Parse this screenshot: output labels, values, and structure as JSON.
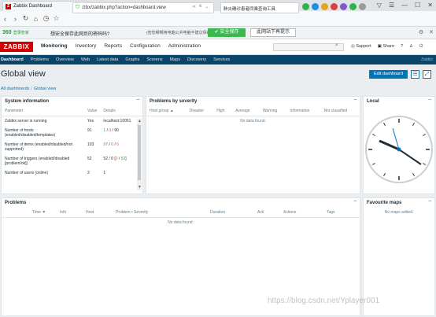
{
  "browser": {
    "tab_title": "Zabbix Dashboard",
    "tab_close": "×",
    "new_tab": "+",
    "url": "/zbx/zabbix.php?action=dashboard.view",
    "search_text": "肺炎确诊患者同乘查询工具",
    "window_controls": [
      "▽",
      "☰",
      "—",
      "☐",
      "✕"
    ]
  },
  "infobar": {
    "logo": "360",
    "logo_sub": "登录管家",
    "question": "想安全保存此网页的密码吗?",
    "note": "(密您哪哪用电脑公共电脑不建议保存)",
    "save_button": "✔ 安全保存",
    "never_button": "此网站下再提示"
  },
  "topnav": {
    "logo": "ZABBIX",
    "menu": [
      "Monitoring",
      "Inventory",
      "Reports",
      "Configuration",
      "Administration"
    ],
    "links": [
      "Support",
      "Share",
      "?"
    ]
  },
  "submenu": {
    "items": [
      "Dashboard",
      "Problems",
      "Overview",
      "Web",
      "Latest data",
      "Graphs",
      "Screens",
      "Maps",
      "Discovery",
      "Services"
    ],
    "brand": "Zabbix"
  },
  "page": {
    "title": "Global view",
    "edit_button": "Edit dashboard",
    "breadcrumbs": [
      "All dashboards",
      "Global view"
    ]
  },
  "system_info": {
    "title": "System information",
    "columns": [
      "Parameter",
      "Value",
      "Details"
    ],
    "rows": [
      {
        "param": "Zabbix server is running",
        "value": "Yes",
        "details": "localhost:10051"
      },
      {
        "param": "Number of hosts (enabled/disabled/templates)",
        "value": "91",
        "d1": "1",
        "d2": "0",
        "d3": "90"
      },
      {
        "param": "Number of items (enabled/disabled/not supported)",
        "value": "103",
        "d1": "97",
        "d2": "0",
        "d3": "6"
      },
      {
        "param": "Number of triggers (enabled/disabled [problem/ok])",
        "value": "52",
        "d1": "52",
        "d2": "0",
        "d3": "0",
        "d4": "52"
      },
      {
        "param": "Number of users (online)",
        "value": "2",
        "details": "1"
      }
    ]
  },
  "problems_by_severity": {
    "title": "Problems by severity",
    "columns": [
      "Host group ▲",
      "Disaster",
      "High",
      "Average",
      "Warning",
      "Information",
      "Not classified"
    ],
    "empty": "No data found."
  },
  "local_clock": {
    "title": "Local"
  },
  "problems": {
    "title": "Problems",
    "columns": [
      "Time ▼",
      "Info",
      "Host",
      "Problem • Severity",
      "Duration",
      "Ack",
      "Actions",
      "Tags"
    ],
    "empty": "No data found."
  },
  "favourite_maps": {
    "title": "Favourite maps",
    "empty": "No maps added."
  },
  "watermark": "https://blog.csdn.net/Yplayer001"
}
